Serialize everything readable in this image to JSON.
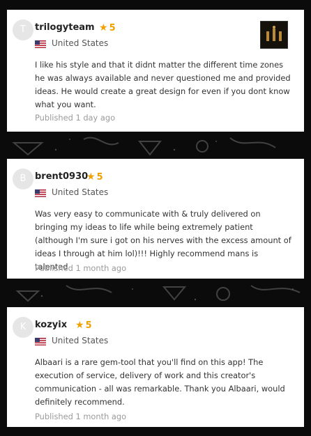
{
  "reviews": [
    {
      "avatar_letter": "T",
      "username": "trilogyteam",
      "rating": "5",
      "country": "United States",
      "text": "I like his style and that it didnt matter the different time zones he was always available and never questioned me and provided ideas. He would create a great design for even if you dont know what you want.",
      "published": "Published 1 day ago",
      "has_thumbnail": true
    },
    {
      "avatar_letter": "B",
      "username": "brent0930",
      "rating": "5",
      "country": "United States",
      "text": "Was very easy to communicate with & truly delivered on bringing my ideas to life while being extremely patient (although I'm sure i got on his nerves with the excess amount of ideas I through at him lol)!!! Highly recommend mans is talented",
      "published": "Published 1 month ago",
      "has_thumbnail": false
    },
    {
      "avatar_letter": "K",
      "username": "kozyix",
      "rating": "5",
      "country": "United States",
      "text": "Albaari is a rare gem-tool that you'll find on this app! The execution of service, delivery of work and this creator's communication - all was remarkable. Thank you Albaari, would definitely recommend.",
      "published": "Published 1 month ago",
      "has_thumbnail": false
    }
  ],
  "colors": {
    "star": "#f0a100",
    "background": "#0b0b0b",
    "card": "#ffffff"
  }
}
